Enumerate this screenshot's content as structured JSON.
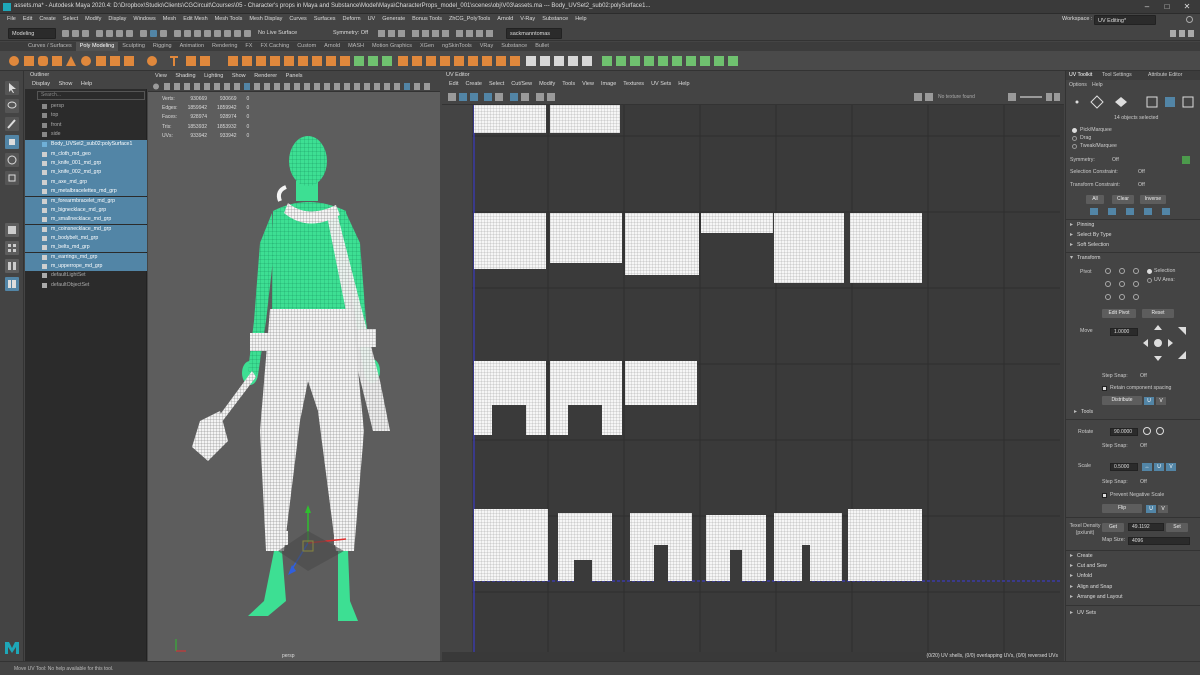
{
  "window": {
    "title": "assets.ma* - Autodesk Maya 2020.4: D:\\Dropbox\\Studio\\Clients\\CGCircuit\\Courses\\05 - Character's props in Maya and Substance\\Model\\Maya\\CharacterProps_model_001\\scenes\\obj\\V03\\assets.ma --- Body_UVSet2_sub02:polySurface1..."
  },
  "menubar": [
    "File",
    "Edit",
    "Create",
    "Select",
    "Modify",
    "Display",
    "Windows",
    "Mesh",
    "Edit Mesh",
    "Mesh Tools",
    "Mesh Display",
    "Curves",
    "Surfaces",
    "Deform",
    "UV",
    "Generate",
    "Bonus Tools",
    "ZhCG_PolyTools",
    "Arnold",
    "V-Ray",
    "Substance",
    "Help"
  ],
  "workspace": {
    "label": "Workspace :",
    "value": "UV Editing*"
  },
  "statusline": {
    "mode": "Modeling",
    "live_surface": "No Live Surface",
    "symmetry": "Symmetry: Off",
    "user": "sackmanntomas"
  },
  "shelf_tabs": [
    "Curves / Surfaces",
    "Poly Modeling",
    "Sculpting",
    "Rigging",
    "Animation",
    "Rendering",
    "FX",
    "FX Caching",
    "Custom",
    "Arnold",
    "MASH",
    "Motion Graphics",
    "XGen",
    "ngSkinTools",
    "VRay",
    "Substance",
    "Bullet"
  ],
  "shelf_active": "Poly Modeling",
  "outliner": {
    "title": "Outliner",
    "menu": [
      "Display",
      "Show",
      "Help"
    ],
    "search_placeholder": "Search...",
    "cameras": [
      "persp",
      "top",
      "front",
      "side"
    ],
    "items": [
      "Body_UVSet2_sub02:polySurface1",
      "m_cloth_md_geo",
      "m_knife_001_md_grp",
      "m_knife_002_md_grp",
      "m_axe_md_grp",
      "m_metalbracelettes_md_grp",
      "m_forearmbracelet_md_grp",
      "m_bignecklace_md_grp",
      "m_smallnecklace_md_grp",
      "m_coinsnecklace_md_grp",
      "m_bodybelt_md_grp",
      "m_belts_md_grp",
      "m_earrings_md_grp",
      "m_upperrope_md_grp"
    ],
    "sets": [
      "defaultLightSet",
      "defaultObjectSet"
    ]
  },
  "viewport": {
    "menu": [
      "View",
      "Shading",
      "Lighting",
      "Show",
      "Renderer",
      "Panels"
    ],
    "camera": "persp",
    "hud": [
      [
        "Verts:",
        "930669",
        "930669",
        "0"
      ],
      [
        "Edges:",
        "1859942",
        "1859942",
        "0"
      ],
      [
        "Faces:",
        "928974",
        "928974",
        "0"
      ],
      [
        "Tris:",
        "1853932",
        "1853932",
        "0"
      ],
      [
        "UVs:",
        "933942",
        "933942",
        "0"
      ]
    ]
  },
  "uv_editor": {
    "title": "UV Editor",
    "menu": [
      "Edit",
      "Create",
      "Select",
      "Cut/Sew",
      "Modify",
      "Tools",
      "View",
      "Image",
      "Textures",
      "UV Sets",
      "Help"
    ],
    "texture": "No texture found",
    "status": "(0/20) UV shells, (0/0) overlapping UVs, (0/0) reversed UVs"
  },
  "toolkit": {
    "tabs": [
      "UV Toolkit",
      "Tool Settings",
      "Attribute Editor"
    ],
    "menu": [
      "Options",
      "Help"
    ],
    "selected": "14 objects selected",
    "modes": [
      "Pick/Marquee",
      "Drag",
      "Tweak/Marquee"
    ],
    "symmetry": {
      "label": "Symmetry:",
      "value": "Off"
    },
    "selection_constraint": {
      "label": "Selection Constraint:",
      "value": "Off"
    },
    "transform_constraint": {
      "label": "Transform Constraint:",
      "value": "Off"
    },
    "sel_buttons": [
      "All",
      "Clear",
      "Inverse"
    ],
    "sections_top": [
      "Pinning",
      "Select By Type",
      "Soft Selection"
    ],
    "transform": {
      "title": "Transform",
      "pivot": "Pivot",
      "pivot_selection": "Selection",
      "pivot_uv": "UV Area:",
      "edit_pivot": "Edit Pivot",
      "reset": "Reset",
      "move": "Move",
      "move_val": "1.0000",
      "step_snap": "Step Snap:",
      "step_off": "Off",
      "retain": "Retain component spacing",
      "distribute": "Distribute",
      "tools": "Tools",
      "rotate": "Rotate",
      "rotate_val": "90.0000",
      "scale": "Scale",
      "scale_val": "0.5000",
      "prevent": "Prevent Negative Scale",
      "flip": "Flip",
      "u": "U",
      "v": "V"
    },
    "texel": {
      "label": "Texel Density (px/unit)",
      "get": "Get",
      "value": "49.1192",
      "set": "Set",
      "map_label": "Map Size:",
      "map_value": "4096"
    },
    "sections_bottom": [
      "Create",
      "Cut and Sew",
      "Unfold",
      "Align and Snap",
      "Arrange and Layout"
    ],
    "uvsets": "UV Sets"
  },
  "helpline": "Move UV Tool: No help available for this tool."
}
